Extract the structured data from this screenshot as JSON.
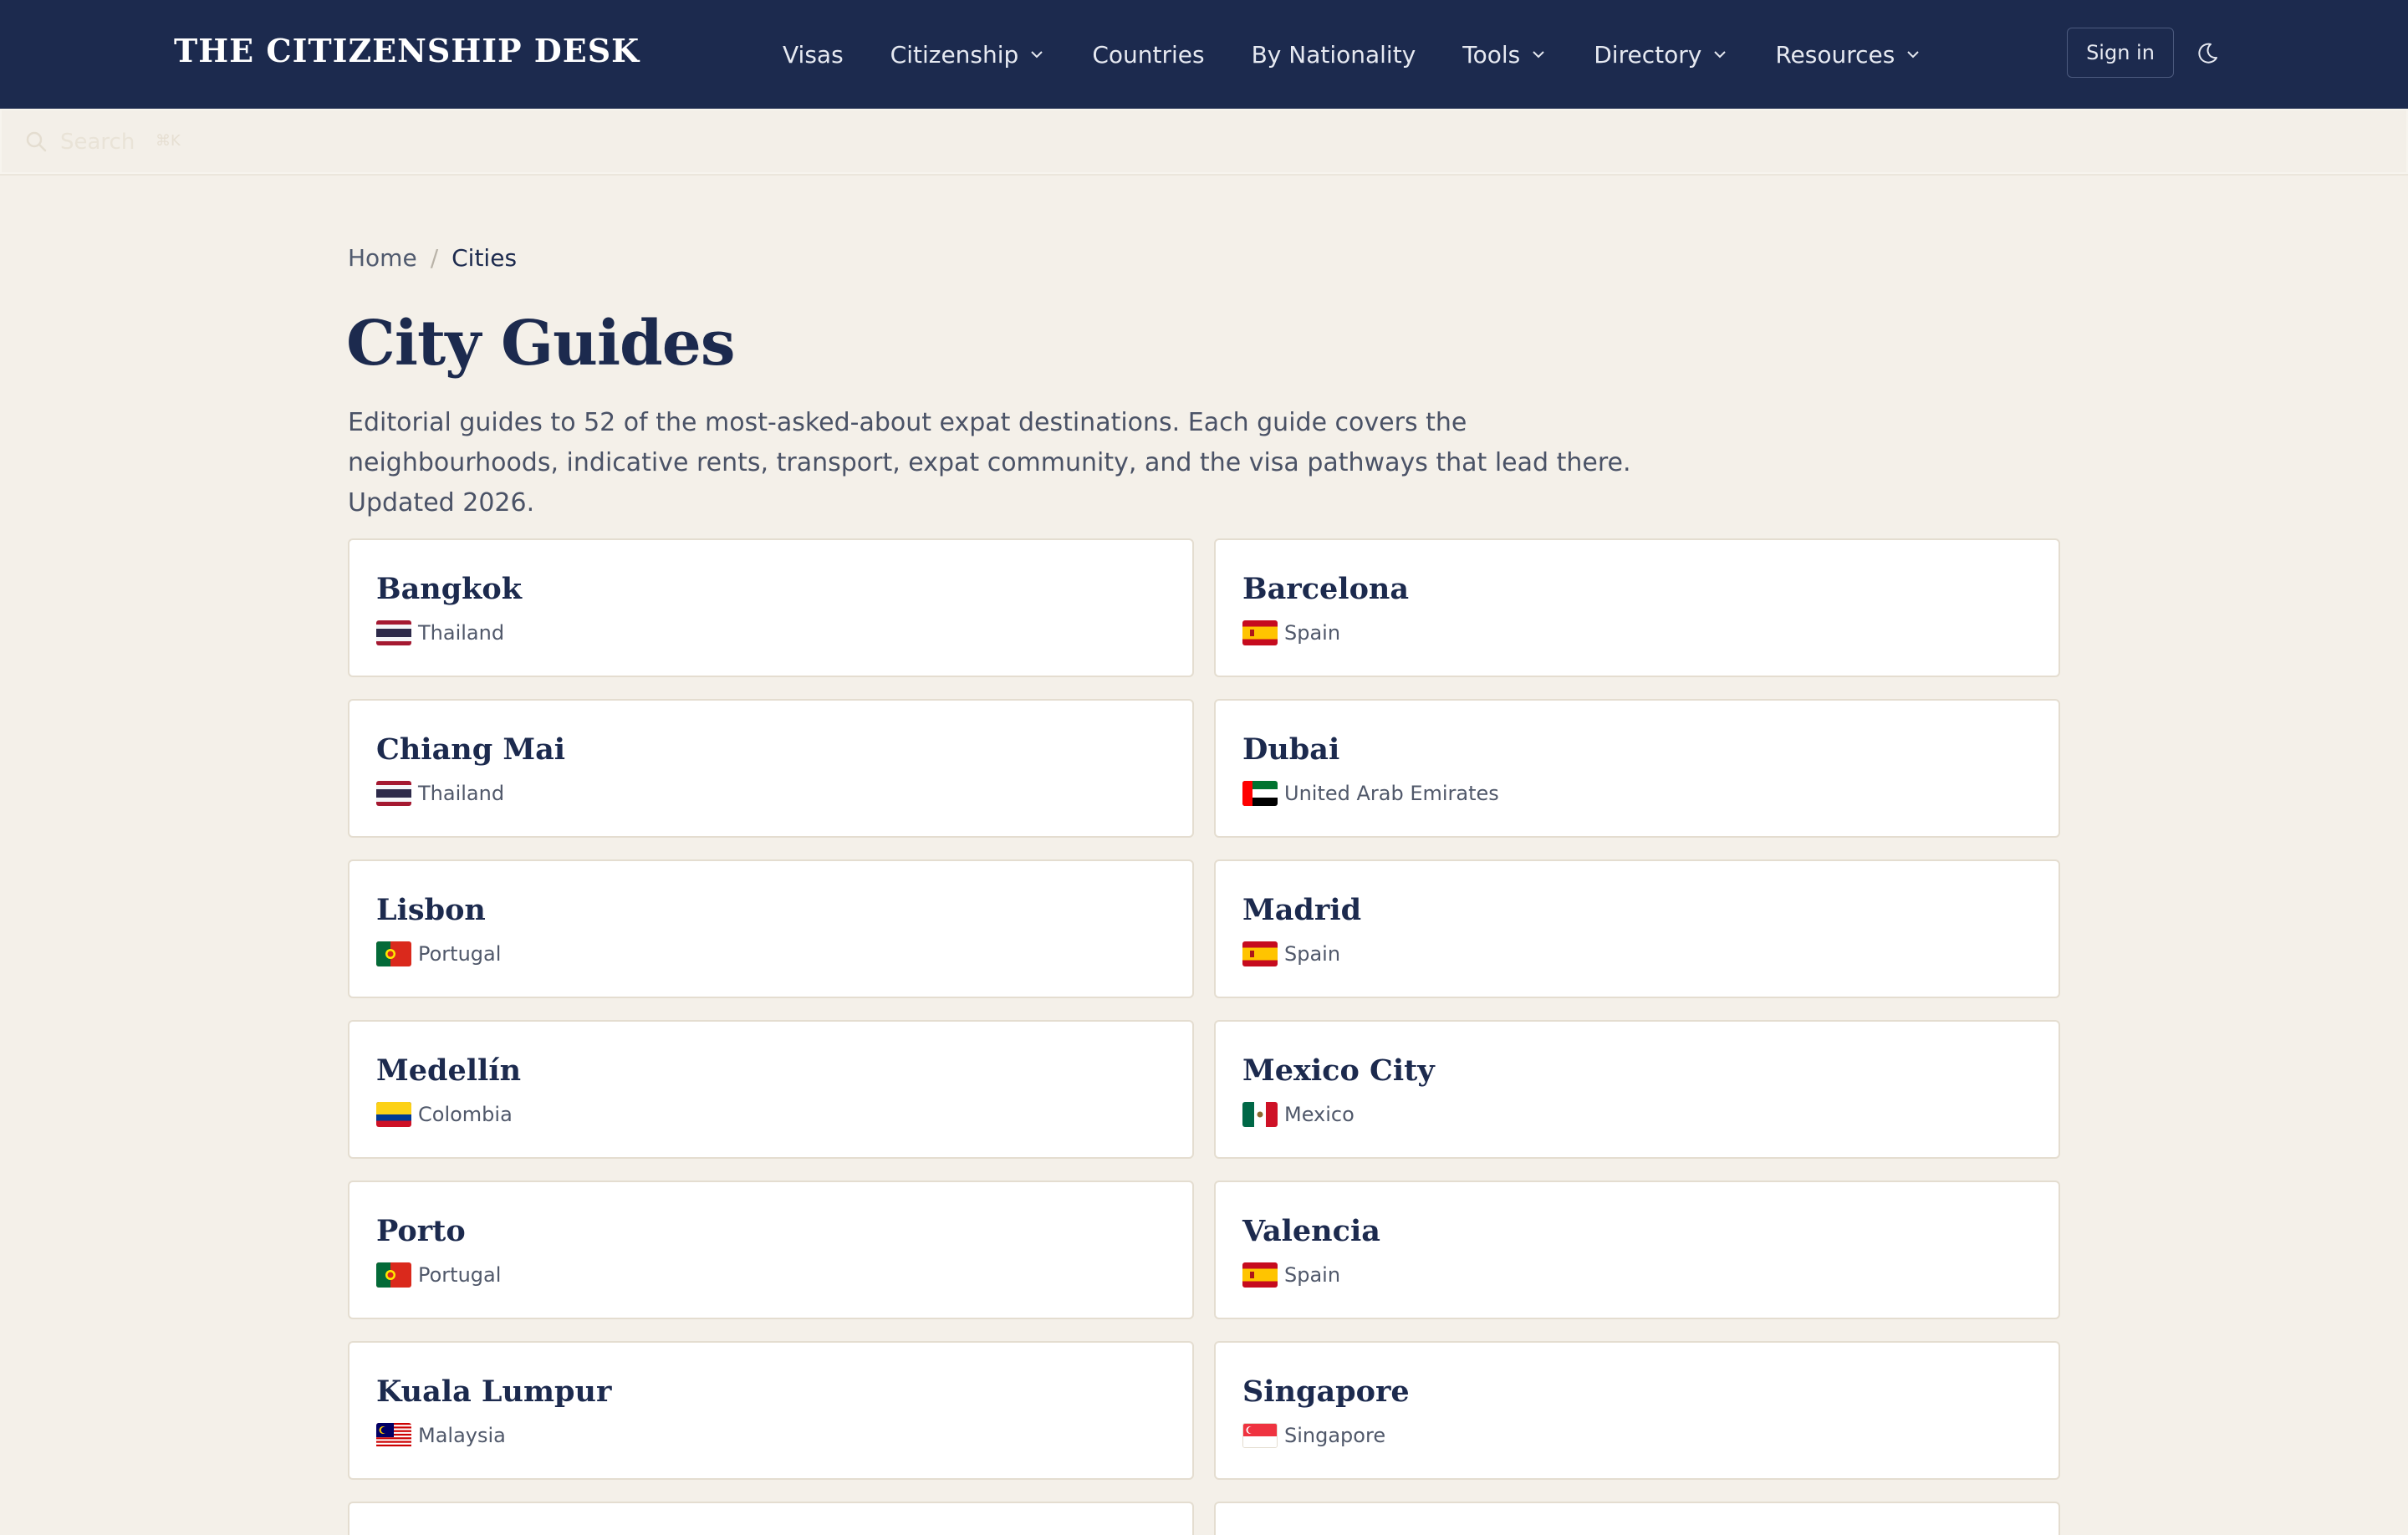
{
  "header": {
    "brand": "THE CITIZENSHIP DESK",
    "nav": [
      {
        "label": "Visas",
        "has_dropdown": false
      },
      {
        "label": "Citizenship",
        "has_dropdown": true
      },
      {
        "label": "Countries",
        "has_dropdown": false
      },
      {
        "label": "By Nationality",
        "has_dropdown": false
      },
      {
        "label": "Tools",
        "has_dropdown": true
      },
      {
        "label": "Directory",
        "has_dropdown": true
      },
      {
        "label": "Resources",
        "has_dropdown": true
      }
    ],
    "signin_label": "Sign in",
    "theme_toggle_icon": "moon-icon",
    "colors": {
      "bar": "#1c2a4e",
      "text": "#ffffff"
    }
  },
  "search": {
    "placeholder": "Search",
    "shortcut": "⌘K",
    "icon": "search-icon"
  },
  "breadcrumb": {
    "home": "Home",
    "separator": "/",
    "current": "Cities"
  },
  "page": {
    "title": "City Guides",
    "intro": "Editorial guides to 52 of the most-asked-about expat destinations. Each guide covers the neighbourhoods, indicative rents, transport, expat community, and the visa pathways that lead there. Updated 2026."
  },
  "cities": [
    {
      "city": "Bangkok",
      "country": "Thailand",
      "flag": "thailand-flag-icon"
    },
    {
      "city": "Barcelona",
      "country": "Spain",
      "flag": "spain-flag-icon"
    },
    {
      "city": "Chiang Mai",
      "country": "Thailand",
      "flag": "thailand-flag-icon"
    },
    {
      "city": "Dubai",
      "country": "United Arab Emirates",
      "flag": "uae-flag-icon"
    },
    {
      "city": "Lisbon",
      "country": "Portugal",
      "flag": "portugal-flag-icon"
    },
    {
      "city": "Madrid",
      "country": "Spain",
      "flag": "spain-flag-icon"
    },
    {
      "city": "Medellín",
      "country": "Colombia",
      "flag": "colombia-flag-icon"
    },
    {
      "city": "Mexico City",
      "country": "Mexico",
      "flag": "mexico-flag-icon"
    },
    {
      "city": "Porto",
      "country": "Portugal",
      "flag": "portugal-flag-icon"
    },
    {
      "city": "Valencia",
      "country": "Spain",
      "flag": "spain-flag-icon"
    },
    {
      "city": "Kuala Lumpur",
      "country": "Malaysia",
      "flag": "malaysia-flag-icon"
    },
    {
      "city": "Singapore",
      "country": "Singapore",
      "flag": "singapore-flag-icon"
    }
  ]
}
